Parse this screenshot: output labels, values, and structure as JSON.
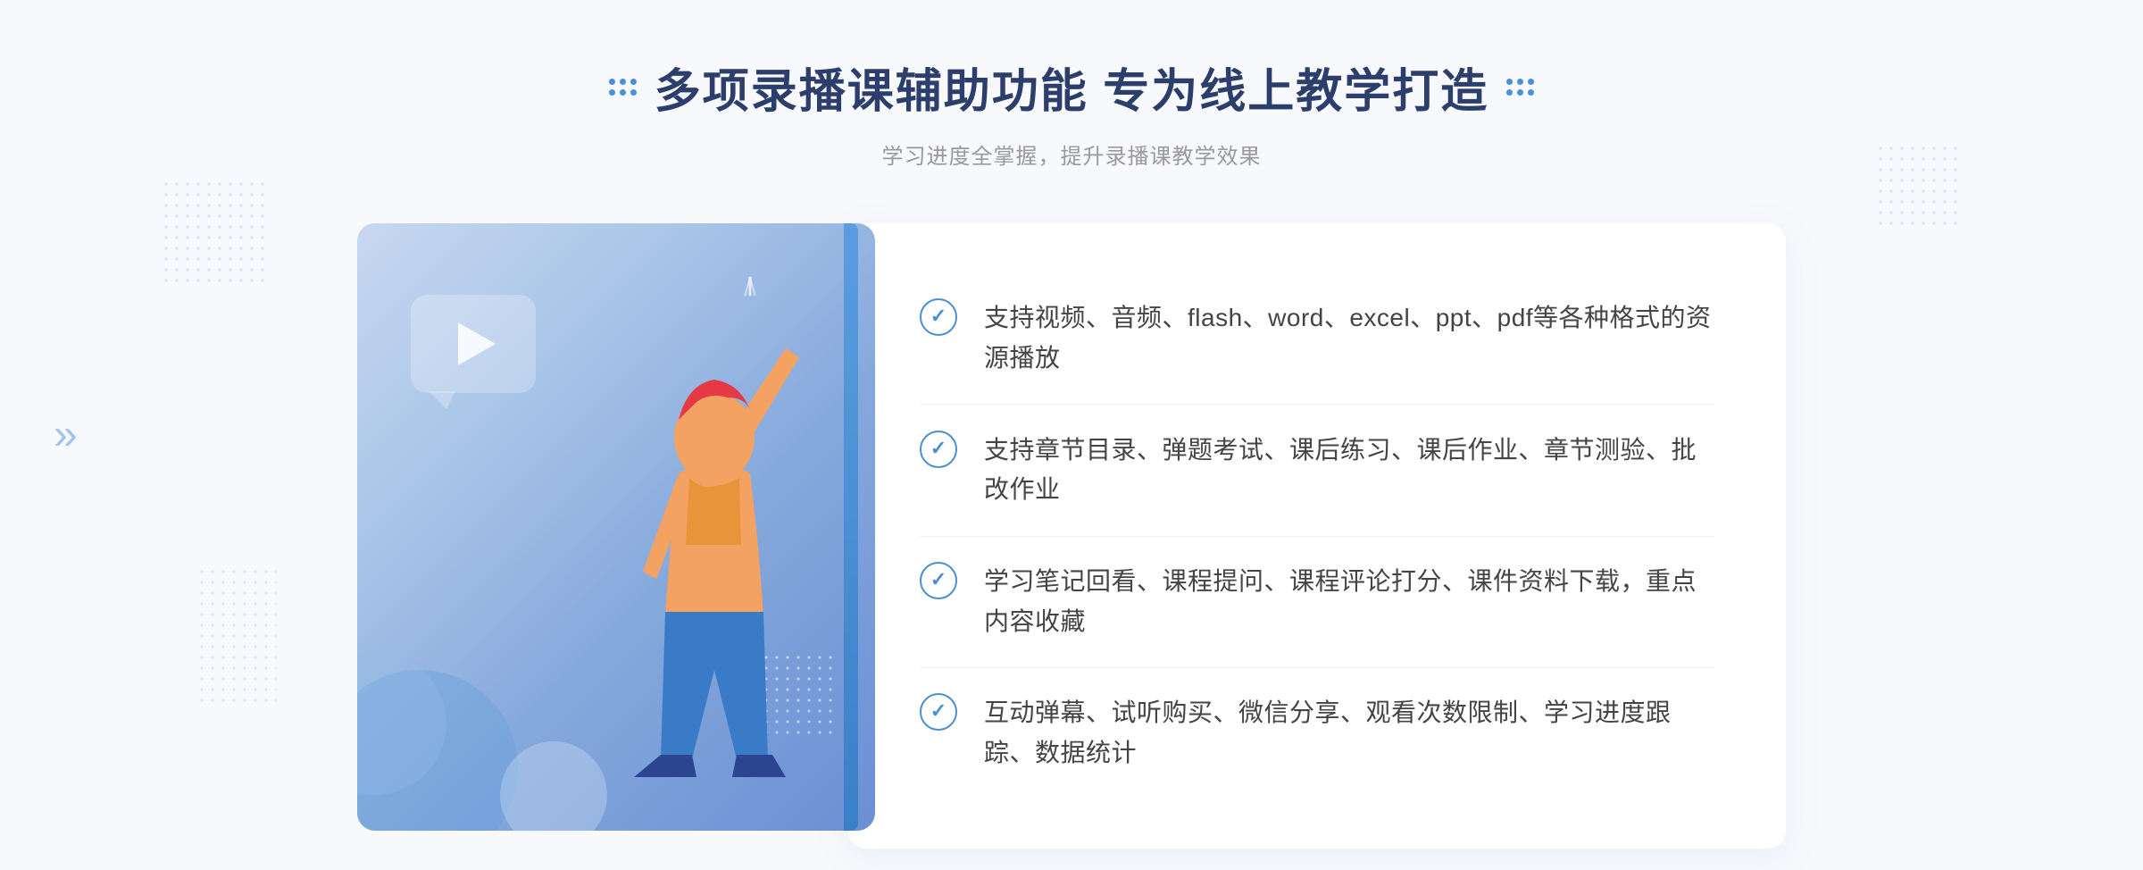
{
  "header": {
    "title": "多项录播课辅助功能 专为线上教学打造",
    "subtitle": "学习进度全掌握，提升录播课教学效果"
  },
  "features": [
    {
      "id": 1,
      "text": "支持视频、音频、flash、word、excel、ppt、pdf等各种格式的资源播放"
    },
    {
      "id": 2,
      "text": "支持章节目录、弹题考试、课后练习、课后作业、章节测验、批改作业"
    },
    {
      "id": 3,
      "text": "学习笔记回看、课程提问、课程评论打分、课件资料下载，重点内容收藏"
    },
    {
      "id": 4,
      "text": "互动弹幕、试听购买、微信分享、观看次数限制、学习进度跟踪、数据统计"
    }
  ],
  "decorations": {
    "arrow_left": "»",
    "play_label": "play-button"
  }
}
